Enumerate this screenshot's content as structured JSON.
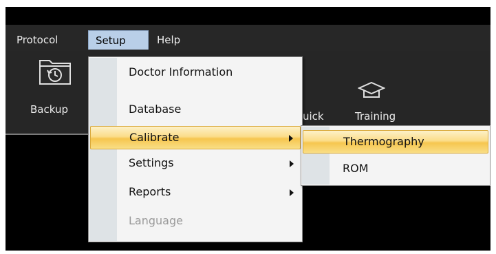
{
  "menubar": {
    "items": [
      {
        "label": "Protocol"
      },
      {
        "label": "Setup"
      },
      {
        "label": "Help"
      }
    ]
  },
  "ribbon": {
    "backup_label": "Backup",
    "quick_label": "uick",
    "training_label": "Training"
  },
  "setup_menu": {
    "items": [
      {
        "label": "Doctor Information"
      },
      {
        "label": "Database"
      },
      {
        "label": "Calibrate"
      },
      {
        "label": "Settings"
      },
      {
        "label": "Reports"
      },
      {
        "label": "Language"
      }
    ]
  },
  "calibrate_submenu": {
    "items": [
      {
        "label": "Thermography"
      },
      {
        "label": "ROM"
      }
    ]
  },
  "icons": [
    "backup-folder-clock-icon",
    "training-graduation-cap-icon",
    "submenu-arrow-icon"
  ],
  "colors": {
    "menubar_bg": "#272727",
    "active_menu_bg": "#b9cfe8",
    "menu_bg": "#f4f4f4",
    "highlight": "#f9d56f",
    "disabled_text": "#9a9a9a"
  }
}
